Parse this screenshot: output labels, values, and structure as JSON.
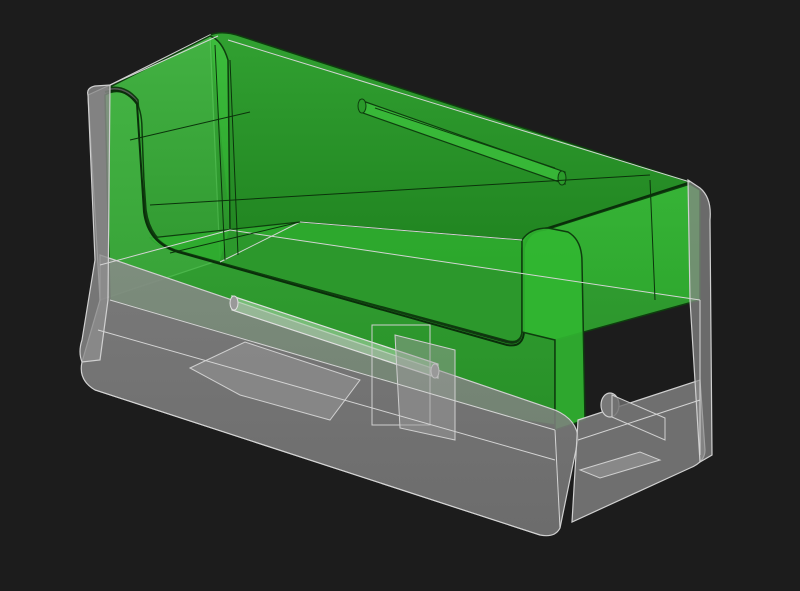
{
  "viewport": {
    "background_color": "#1c1c1c"
  },
  "model": {
    "shell_color": "#8d8d8d",
    "shell_edge_color": "#d0d0d0",
    "tray_color": "#25b625",
    "tray_edge_color": "#0d3a0d",
    "highlight_color": "#66e266"
  }
}
